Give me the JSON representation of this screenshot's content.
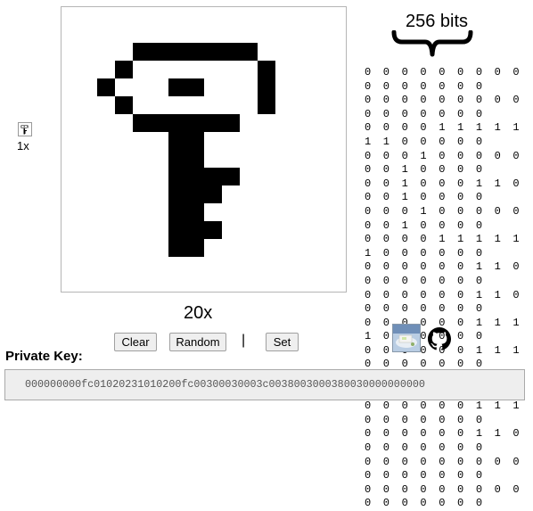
{
  "bitmap": [
    "0000000000000000",
    "0000000000000000",
    "0000111111100000",
    "0001000000010000",
    "0010001100010000",
    "0001000000010000",
    "0000111111000000",
    "0000001100000000",
    "0000001100000000",
    "0000001111000000",
    "0000001110000000",
    "0000001100000000",
    "0000001110000000",
    "0000001100000000",
    "0000000000000000",
    "0000000000000000"
  ],
  "labels": {
    "small_zoom": "1x",
    "big_zoom": "20x",
    "bits": "256 bits",
    "separator": "|"
  },
  "buttons": {
    "clear": "Clear",
    "random": "Random",
    "set": "Set"
  },
  "private_key": {
    "label": "Private Key:",
    "value": "000000000fc01020231010200fc00300030003c0038003000380030000000000"
  },
  "icons": {
    "photo": "photo-icon",
    "github": "github-icon",
    "key": "key-icon"
  },
  "colors": {
    "pixel_on": "#000000",
    "pixel_off": "#ffffff",
    "frame_border": "#b5b5b5"
  }
}
